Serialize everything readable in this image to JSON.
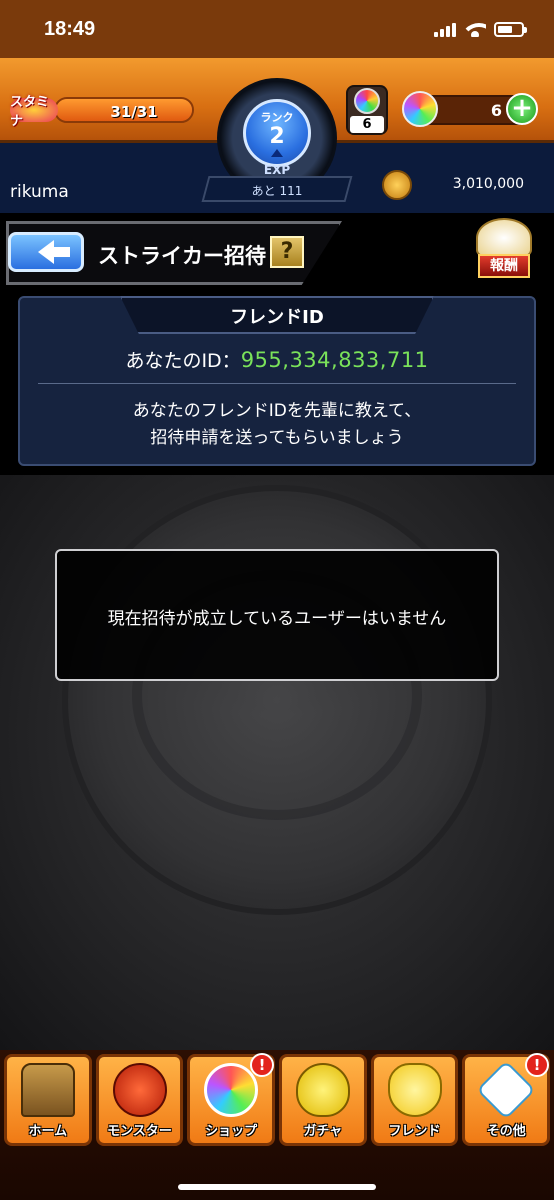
{
  "status_bar": {
    "time": "18:49"
  },
  "hud": {
    "stamina_icon": "スタミナ",
    "stamina": "31/31",
    "stamina_fraction": 1.0,
    "orb_count": "6",
    "gem_count": "6",
    "plus": "+",
    "rank_label": "ランク",
    "rank_value": "2",
    "exp_label": "EXP",
    "exp_remaining": "あと 111",
    "username": "rikuma",
    "gold": "3,010,000"
  },
  "header": {
    "title": "ストライカー招待",
    "help": "?",
    "reward_label": "報酬"
  },
  "friend_id_panel": {
    "heading": "フレンドID",
    "id_label": "あなたのID：",
    "id_value": "955,334,833,711",
    "description_line1": "あなたのフレンドIDを先輩に教えて、",
    "description_line2": "招待申請を送ってもらいましょう"
  },
  "empty_state": {
    "message": "現在招待が成立しているユーザーはいません"
  },
  "nav": {
    "items": [
      {
        "label": "ホーム",
        "alert": ""
      },
      {
        "label": "モンスター",
        "alert": ""
      },
      {
        "label": "ショップ",
        "alert": "!"
      },
      {
        "label": "ガチャ",
        "alert": ""
      },
      {
        "label": "フレンド",
        "alert": ""
      },
      {
        "label": "その他",
        "alert": "!"
      }
    ]
  },
  "colors": {
    "hud_orange": "#f29a2e",
    "id_green": "#7ae25a",
    "panel_navy": "#16233f"
  }
}
